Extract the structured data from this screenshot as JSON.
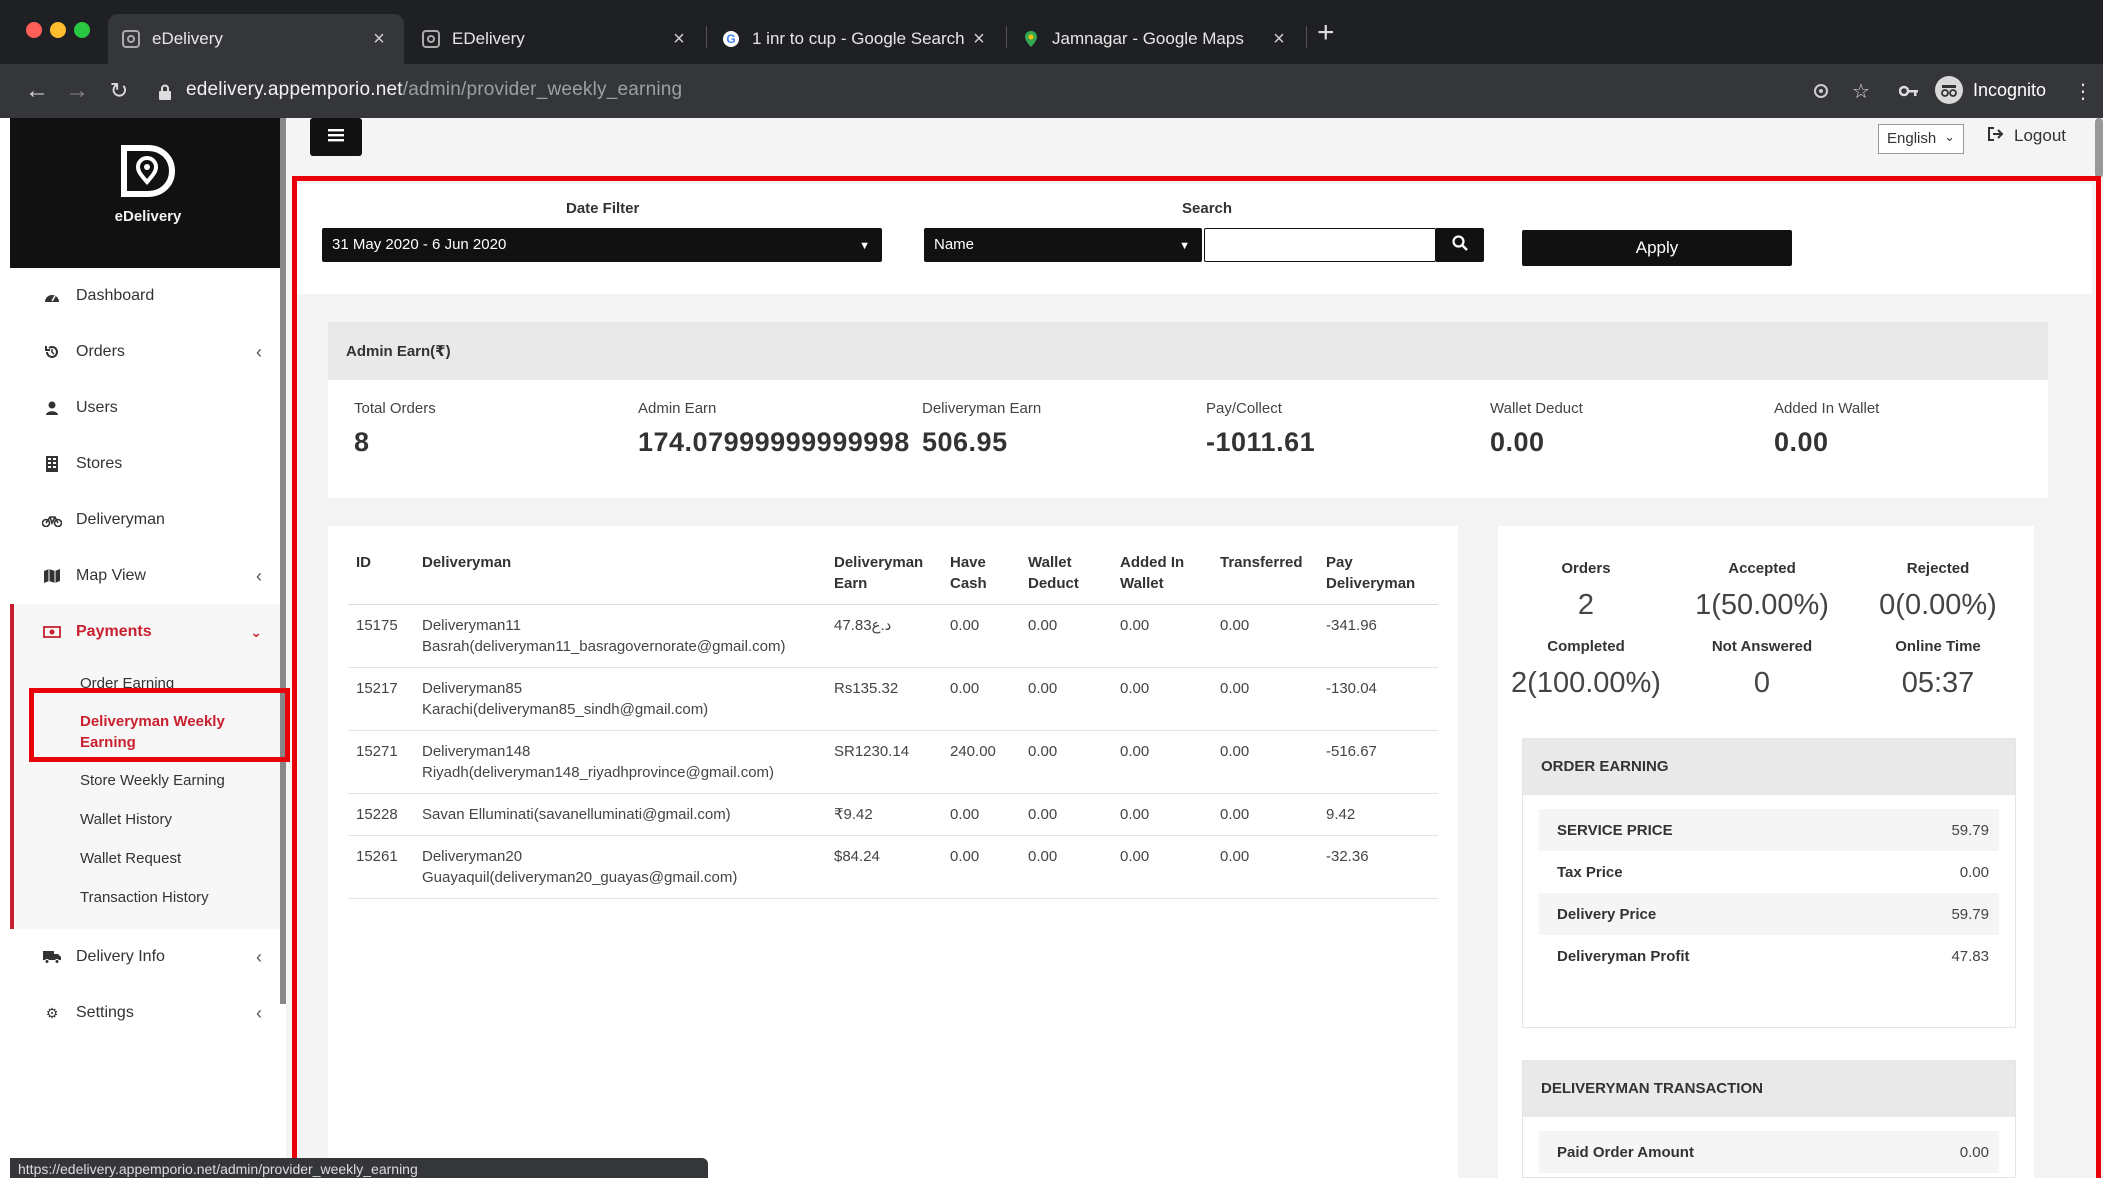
{
  "browser": {
    "tabs": [
      {
        "label": "eDelivery",
        "active": true
      },
      {
        "label": "EDelivery",
        "active": false
      },
      {
        "label": "1 inr to cup - Google Search",
        "active": false
      },
      {
        "label": "Jamnagar - Google Maps",
        "active": false
      }
    ],
    "url_host": "edelivery.appemporio.net",
    "url_path": "/admin/provider_weekly_earning",
    "incognito_label": "Incognito",
    "status_url": "https://edelivery.appemporio.net/admin/provider_weekly_earning"
  },
  "sidebar": {
    "brand": "eDelivery",
    "items": [
      {
        "label": "Dashboard",
        "icon": "dashboard-icon"
      },
      {
        "label": "Orders",
        "icon": "history-icon"
      },
      {
        "label": "Users",
        "icon": "user-icon"
      },
      {
        "label": "Stores",
        "icon": "building-icon"
      },
      {
        "label": "Deliveryman",
        "icon": "bicycle-icon"
      },
      {
        "label": "Map View",
        "icon": "map-icon"
      },
      {
        "label": "Payments",
        "icon": "money-icon"
      },
      {
        "label": "Delivery Info",
        "icon": "truck-icon"
      },
      {
        "label": "Settings",
        "icon": "gear-icon"
      }
    ],
    "payments_sub": [
      {
        "label": "Order Earning"
      },
      {
        "label": "Deliveryman Weekly Earning"
      },
      {
        "label": "Store Weekly Earning"
      },
      {
        "label": "Wallet History"
      },
      {
        "label": "Wallet Request"
      },
      {
        "label": "Transaction History"
      }
    ]
  },
  "header": {
    "language": "English",
    "logout": "Logout"
  },
  "filter": {
    "date_label": "Date Filter",
    "date_value": "31 May 2020 - 6 Jun 2020",
    "search_label": "Search",
    "search_field": "Name",
    "search_value": "",
    "apply": "Apply"
  },
  "admin_earn": {
    "title": "Admin Earn(₹)",
    "kpis": [
      {
        "label": "Total Orders",
        "value": "8"
      },
      {
        "label": "Admin Earn",
        "value": "174.07999999999998"
      },
      {
        "label": "Deliveryman Earn",
        "value": "506.95"
      },
      {
        "label": "Pay/Collect",
        "value": "-1011.61"
      },
      {
        "label": "Wallet Deduct",
        "value": "0.00"
      },
      {
        "label": "Added In Wallet",
        "value": "0.00"
      }
    ]
  },
  "table": {
    "headers": [
      "ID",
      "Deliveryman",
      "Deliveryman Earn",
      "Have Cash",
      "Wallet Deduct",
      "Added In Wallet",
      "Transferred",
      "Pay Deliveryman"
    ],
    "rows": [
      {
        "id": "15175",
        "name": "Deliveryman11",
        "detail": "Basrah(deliveryman11_basragovernorate@gmail.com)",
        "earn": "47.83د.ع",
        "cash": "0.00",
        "wallet_deduct": "0.00",
        "added": "0.00",
        "transferred": "0.00",
        "pay": "-341.96"
      },
      {
        "id": "15217",
        "name": "Deliveryman85",
        "detail": "Karachi(deliveryman85_sindh@gmail.com)",
        "earn": "Rs135.32",
        "cash": "0.00",
        "wallet_deduct": "0.00",
        "added": "0.00",
        "transferred": "0.00",
        "pay": "-130.04"
      },
      {
        "id": "15271",
        "name": "Deliveryman148",
        "detail": "Riyadh(deliveryman148_riyadhprovince@gmail.com)",
        "earn": "SR1230.14",
        "cash": "240.00",
        "wallet_deduct": "0.00",
        "added": "0.00",
        "transferred": "0.00",
        "pay": "-516.67"
      },
      {
        "id": "15228",
        "name": "Savan Elluminati(savanelluminati@gmail.com)",
        "detail": "",
        "earn": "₹9.42",
        "cash": "0.00",
        "wallet_deduct": "0.00",
        "added": "0.00",
        "transferred": "0.00",
        "pay": "9.42"
      },
      {
        "id": "15261",
        "name": "Deliveryman20",
        "detail": "Guayaquil(deliveryman20_guayas@gmail.com)",
        "earn": "$84.24",
        "cash": "0.00",
        "wallet_deduct": "0.00",
        "added": "0.00",
        "transferred": "0.00",
        "pay": "-32.36"
      }
    ]
  },
  "stats": {
    "orders": {
      "label": "Orders",
      "value": "2"
    },
    "accepted": {
      "label": "Accepted",
      "value": "1(50.00%)"
    },
    "rejected": {
      "label": "Rejected",
      "value": "0(0.00%)"
    },
    "completed": {
      "label": "Completed",
      "value": "2(100.00%)"
    },
    "not_answered": {
      "label": "Not Answered",
      "value": "0"
    },
    "online_time": {
      "label": "Online Time",
      "value": "05:37"
    }
  },
  "order_earning": {
    "title": "ORDER EARNING",
    "rows": [
      {
        "label": "SERVICE PRICE",
        "value": "59.79"
      },
      {
        "label": "Tax Price",
        "value": "0.00"
      },
      {
        "label": "Delivery Price",
        "value": "59.79"
      },
      {
        "label": "Deliveryman Profit",
        "value": "47.83"
      }
    ]
  },
  "deliveryman_transaction": {
    "title": "DELIVERYMAN TRANSACTION",
    "rows": [
      {
        "label": "Paid Order Amount",
        "value": "0.00"
      }
    ]
  },
  "colors": {
    "accent": "#c8202f",
    "annotation": "#e8000b",
    "dark": "#111111"
  }
}
